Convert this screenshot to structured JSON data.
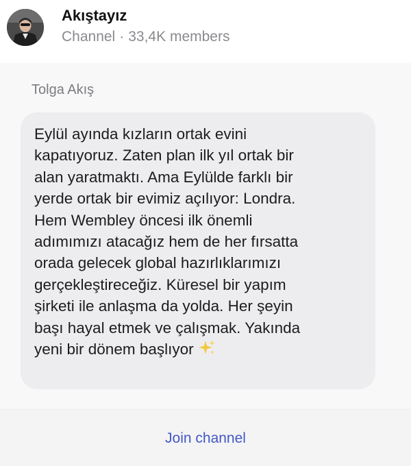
{
  "channel": {
    "name": "Akıştayız",
    "type": "Channel",
    "separator": "·",
    "members": "33,4K members"
  },
  "message": {
    "sender": "Tolga Akış",
    "text": "Eylül ayında kızların ortak evini\nkapatıyoruz. Zaten plan ilk yıl ortak bir\nalan yaratmaktı. Ama Eylülde farklı bir\nyerde ortak bir evimiz açılıyor: Londra.\nHem Wembley öncesi ilk önemli\nadımımızı atacağız hem de her fırsatta\norada gelecek global hazırlıklarımızı\ngerçekleştireceğiz. Küresel bir yapım\nşirketi ile anlaşma da yolda. Her şeyin\nbaşı hayal etmek ve çalışmak. Yakında\nyeni bir dönem başlıyor",
    "emoji_icon": "sparkles-icon"
  },
  "footer": {
    "join_label": "Join channel"
  },
  "colors": {
    "accent": "#4457c7",
    "bubble": "#ededef",
    "meta_text": "#8a8a8e",
    "sparkle": "#f5c842"
  }
}
